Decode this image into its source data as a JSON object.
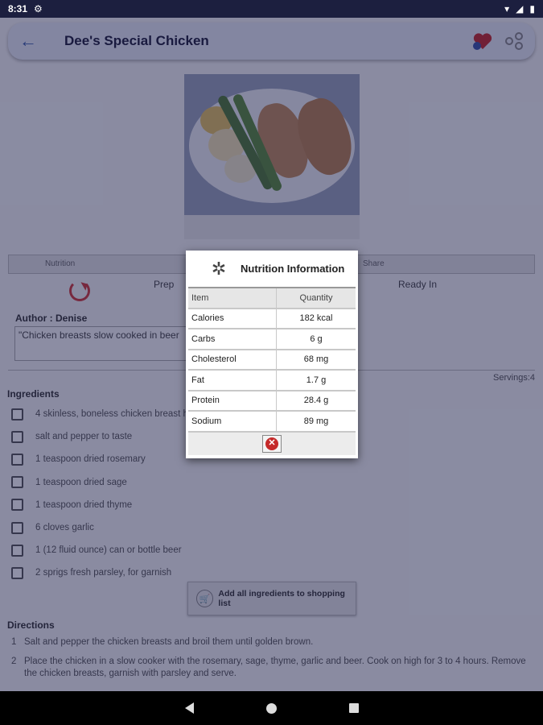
{
  "status": {
    "time": "8:31",
    "signal": "▾",
    "battery": "▮"
  },
  "toolbar": {
    "title": "Dee's Special Chicken"
  },
  "tabs": {
    "left": "Nutrition",
    "right": "Share"
  },
  "times": {
    "prep": "Prep",
    "ready": "Ready In"
  },
  "author": "Author : Denise",
  "description": "\"Chicken breasts slow cooked in beer",
  "servings": "Servings:4",
  "ingredients": {
    "heading": "Ingredients",
    "items": [
      "4 skinless, boneless chicken breast halves",
      "salt and pepper to taste",
      "1 teaspoon dried rosemary",
      "1 teaspoon dried sage",
      "1 teaspoon dried thyme",
      "6 cloves garlic",
      "1 (12 fluid ounce) can or bottle beer",
      "2 sprigs fresh parsley, for garnish"
    ]
  },
  "shopping_button": "Add all ingredients to shopping list",
  "directions": {
    "heading": "Directions",
    "items": [
      {
        "num": "1",
        "text": "Salt and pepper the chicken breasts and broil them until golden brown."
      },
      {
        "num": "2",
        "text": "Place the chicken in a slow cooker with the rosemary, sage, thyme, garlic and beer. Cook on high for 3 to 4 hours. Remove the chicken breasts, garnish with parsley and serve."
      }
    ]
  },
  "dialog": {
    "title": "Nutrition Information",
    "col_item": "Item",
    "col_qty": "Quantity",
    "rows": [
      {
        "item": "Calories",
        "qty": "182 kcal"
      },
      {
        "item": "Carbs",
        "qty": "6 g"
      },
      {
        "item": "Cholesterol",
        "qty": "68 mg"
      },
      {
        "item": "Fat",
        "qty": "1.7 g"
      },
      {
        "item": "Protein",
        "qty": "28.4 g"
      },
      {
        "item": "Sodium",
        "qty": "89 mg"
      }
    ]
  },
  "colors": {
    "accent": "#3a5ca8",
    "overlay": "#14184a",
    "close": "#c52a2a"
  }
}
